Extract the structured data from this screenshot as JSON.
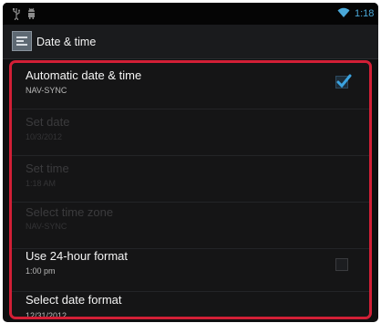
{
  "status_bar": {
    "usb_icon": "usb-icon",
    "android_icon": "android-debug-icon",
    "wifi_icon": "wifi-icon",
    "time": "1:18"
  },
  "action_bar": {
    "icon": "date-time-settings-icon",
    "title": "Date & time"
  },
  "settings": [
    {
      "title": "Automatic date & time",
      "summary": "NAV-SYNC",
      "enabled": true,
      "checkbox": true,
      "checked": true
    },
    {
      "title": "Set date",
      "summary": "10/3/2012",
      "enabled": false
    },
    {
      "title": "Set time",
      "summary": "1:18 AM",
      "enabled": false
    },
    {
      "title": "Select time zone",
      "summary": "NAV-SYNC",
      "enabled": false
    },
    {
      "title": "Use 24-hour format",
      "summary": "1:00 pm",
      "enabled": true,
      "checkbox": true,
      "checked": false
    },
    {
      "title": "Select date format",
      "summary": "12/31/2012",
      "enabled": true
    }
  ],
  "colors": {
    "highlight_border": "#d21f36",
    "accent": "#4aa8d8",
    "background": "#0f0f10"
  }
}
